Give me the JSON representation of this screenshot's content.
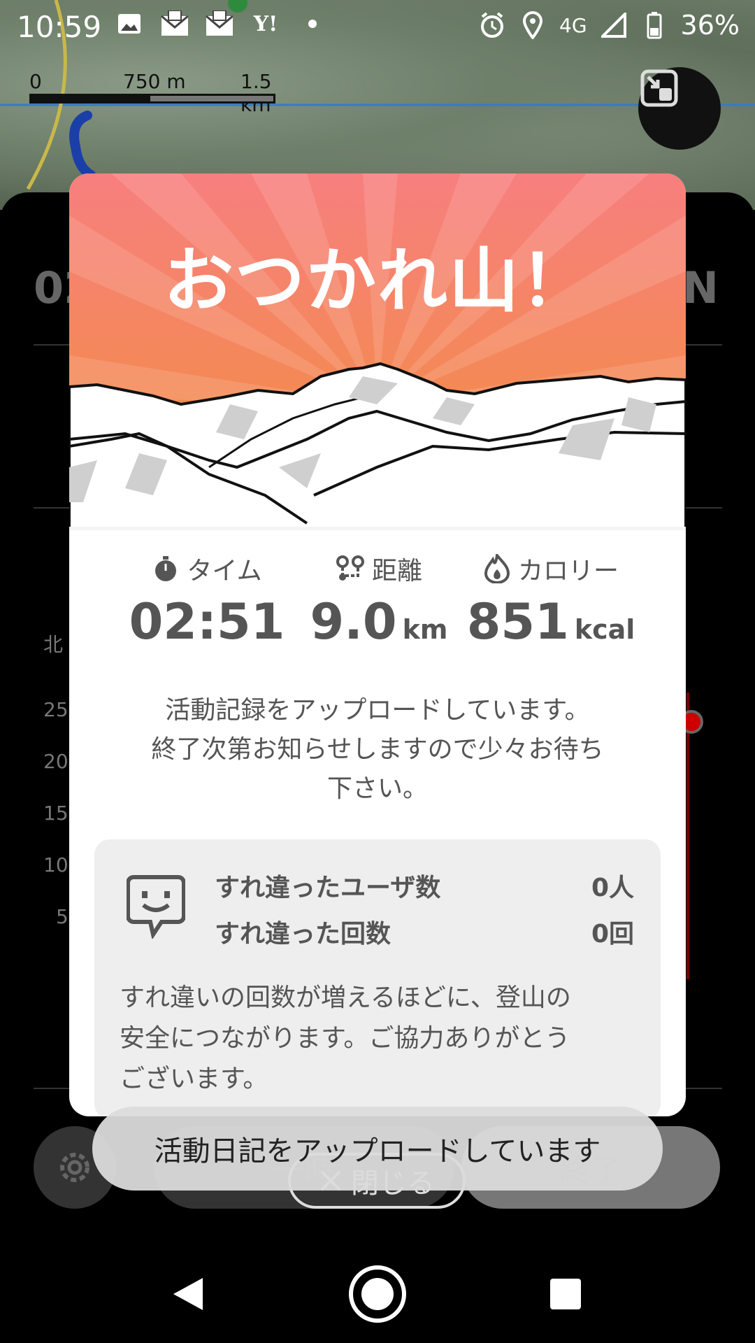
{
  "status_bar": {
    "time": "10:59",
    "left_icons": [
      "image-icon",
      "yahoo-mail-icon",
      "yahoo-mail-icon",
      "yahoo-icon",
      "dot-icon"
    ],
    "network": "4G",
    "battery": "36%"
  },
  "map": {
    "scale_labels": [
      "0",
      "750 m",
      "1.5 km"
    ]
  },
  "background_app": {
    "big_value_fragment": "02",
    "n_label": "N",
    "axis_label_top": "北",
    "axis_ticks": [
      "25",
      "20",
      "15",
      "10",
      "5"
    ],
    "pause_label": "一時",
    "end_label": "終了"
  },
  "dialog": {
    "title": "おつかれ山！",
    "stats": [
      {
        "label": "タイム",
        "value": "02:51",
        "unit": "",
        "icon": "stopwatch-icon"
      },
      {
        "label": "距離",
        "value": "9.0",
        "unit": "km",
        "icon": "route-icon"
      },
      {
        "label": "カロリー",
        "value": "851",
        "unit": "kcal",
        "icon": "flame-icon"
      }
    ],
    "upload_message_line1": "活動記録をアップロードしています。",
    "upload_message_line2": "終了次第お知らせしますので少々お待ち",
    "upload_message_line3": "下さい。",
    "pass": {
      "users_label": "すれ違ったユーザ数",
      "users_value": "0人",
      "count_label": "すれ違った回数",
      "count_value": "0回",
      "note_line1": "すれ違いの回数が増えるほどに、登山の",
      "note_line2": "安全につながります。ご協力ありがとう",
      "note_line3": "ございます。"
    },
    "close_label": "閉じる"
  },
  "toast": {
    "text": "活動日記をアップロードしています"
  },
  "colors": {
    "hero_top": "#f77f7f",
    "hero_bottom": "#f28a3a",
    "text_gray": "#555555"
  }
}
